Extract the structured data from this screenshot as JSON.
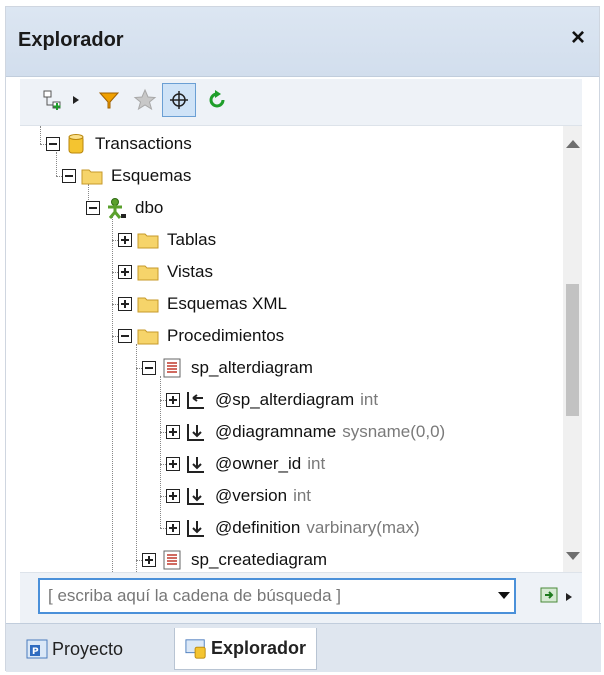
{
  "window": {
    "title": "Explorador",
    "close_glyph": "×"
  },
  "toolbar": {
    "icons": [
      "add-connection-icon",
      "expand-arrow-icon",
      "filter-icon",
      "favorites-star-icon",
      "locate-crosshair-icon",
      "refresh-icon"
    ]
  },
  "tree": {
    "nodes": [
      {
        "label": "Transactions",
        "icon": "database-icon"
      },
      {
        "label": "Esquemas",
        "icon": "folder-icon"
      },
      {
        "label": "dbo",
        "icon": "user-schema-icon"
      },
      {
        "label": "Tablas",
        "icon": "folder-icon"
      },
      {
        "label": "Vistas",
        "icon": "folder-icon"
      },
      {
        "label": "Esquemas XML",
        "icon": "folder-icon"
      },
      {
        "label": "Procedimientos",
        "icon": "folder-icon"
      },
      {
        "label": "sp_alterdiagram",
        "icon": "procedure-icon"
      },
      {
        "label": "@sp_alterdiagram",
        "type": "int",
        "icon": "return-param-icon"
      },
      {
        "label": "@diagramname",
        "type": "sysname(0,0)",
        "icon": "input-param-icon"
      },
      {
        "label": "@owner_id",
        "type": "int",
        "icon": "input-param-icon"
      },
      {
        "label": "@version",
        "type": "int",
        "icon": "input-param-icon"
      },
      {
        "label": "@definition",
        "type": "varbinary(max)",
        "icon": "input-param-icon"
      },
      {
        "label": "sp_creatediagram",
        "icon": "procedure-icon"
      }
    ]
  },
  "search": {
    "placeholder": "[ escriba aquí la cadena de búsqueda ]"
  },
  "tabs": [
    {
      "label": "Proyecto",
      "icon": "project-icon"
    },
    {
      "label": "Explorador",
      "icon": "explorer-icon",
      "active": true
    }
  ],
  "colors": {
    "accent": "#4a90d9",
    "folder": "#f6d46a",
    "database": "#f4c430",
    "refresh": "#1e9e2a",
    "filter": "#e8a000"
  }
}
